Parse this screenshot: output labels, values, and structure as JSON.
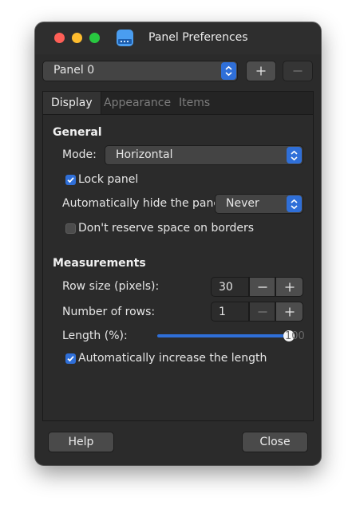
{
  "window": {
    "title": "Panel Preferences",
    "app_icon": "panel-icon"
  },
  "toolbar": {
    "panel_select": "Panel 0",
    "add_label": "+",
    "remove_label": "−"
  },
  "tabs": [
    {
      "label": "Display",
      "active": true
    },
    {
      "label": "Appearance",
      "active": false
    },
    {
      "label": "Items",
      "active": false
    }
  ],
  "general": {
    "heading": "General",
    "mode_label": "Mode:",
    "mode_value": "Horizontal",
    "lock_panel_label": "Lock panel",
    "lock_panel_checked": true,
    "autohide_label": "Automatically hide the panel:",
    "autohide_value": "Never",
    "reserve_space_label": "Don't reserve space on borders",
    "reserve_space_checked": false
  },
  "measurements": {
    "heading": "Measurements",
    "row_size_label": "Row size (pixels):",
    "row_size_value": "30",
    "rows_label": "Number of rows:",
    "rows_value": "1",
    "length_label": "Length (%):",
    "length_value": "100",
    "length_fraction": 1.0,
    "auto_increase_label": "Automatically increase the length",
    "auto_increase_checked": true
  },
  "footer": {
    "help_label": "Help",
    "close_label": "Close"
  },
  "colors": {
    "accent": "#2f6fd8",
    "window_bg": "#2b2b2b",
    "traffic_close": "#fe5f57",
    "traffic_min": "#febc2e",
    "traffic_max": "#28c840"
  }
}
